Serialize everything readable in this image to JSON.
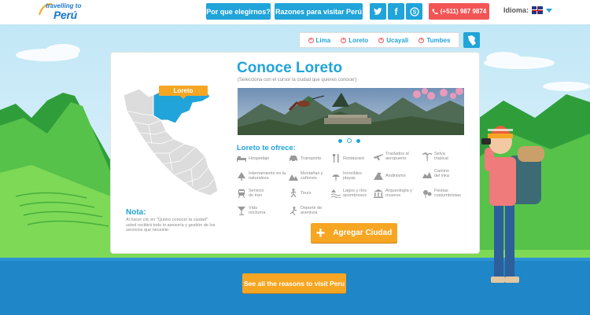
{
  "header": {
    "logo_top": "travelling to",
    "logo_bottom": "Perú",
    "nav": [
      "Por que elegirnos?",
      "Razones para visitar Perú"
    ],
    "phone": "(+511) 987 9874",
    "language_label": "Idioma:"
  },
  "tabs": [
    "Lima",
    "Loreto",
    "Ucayali",
    "Tumbes"
  ],
  "map": {
    "selected_region": "Loreto"
  },
  "nota": {
    "title": "Nota:",
    "text": "Al hacer clic en \"Quiero conocer la ciudad\" usted recibirá todo lo asesoría y gestión de los servicios que necesite."
  },
  "city": {
    "title": "Conoce Loreto",
    "subtitle": "(Selecciona con el cursor la ciudad que quieres conocer)",
    "carousel": {
      "slides": 3,
      "active": 2
    }
  },
  "offers": {
    "title": "Loreto te ofrece:",
    "items": [
      {
        "label": "Hospedaje",
        "icon": "bed-icon"
      },
      {
        "label": "Transporte",
        "icon": "car-icon"
      },
      {
        "label": "Restaurant",
        "icon": "cutlery-icon"
      },
      {
        "label": "Traslados al aeropuerto",
        "icon": "plane-icon"
      },
      {
        "label": "Selva tropical",
        "icon": "palm-tree-icon"
      },
      {
        "label": "Internamiento en la naturaleza",
        "icon": "tree-icon"
      },
      {
        "label": "Montañas y cañones",
        "icon": "mountain-icon"
      },
      {
        "label": "Increíbles playas",
        "icon": "beach-icon"
      },
      {
        "label": "Andinismo",
        "icon": "climbing-icon"
      },
      {
        "label": "Camino del inka",
        "icon": "inca-trail-icon"
      },
      {
        "label": "Servicio de tren",
        "icon": "train-icon"
      },
      {
        "label": "Tours",
        "icon": "hiker-icon"
      },
      {
        "label": "Lagos y ríos asombrosos",
        "icon": "lake-icon"
      },
      {
        "label": "Arqueología y museos",
        "icon": "museum-icon"
      },
      {
        "label": "Fiestas costumbristas",
        "icon": "festival-icon"
      },
      {
        "label": "Vida nocturna",
        "icon": "nightlife-icon"
      },
      {
        "label": "Deporte de aventura",
        "icon": "adventure-icon"
      }
    ]
  },
  "buttons": {
    "add_city": "Agregar Ciudad",
    "reasons": "See all the reasons to visit Peru"
  },
  "colors": {
    "accent": "#20a4d9",
    "orange": "#f6a623",
    "red": "#f35556"
  }
}
